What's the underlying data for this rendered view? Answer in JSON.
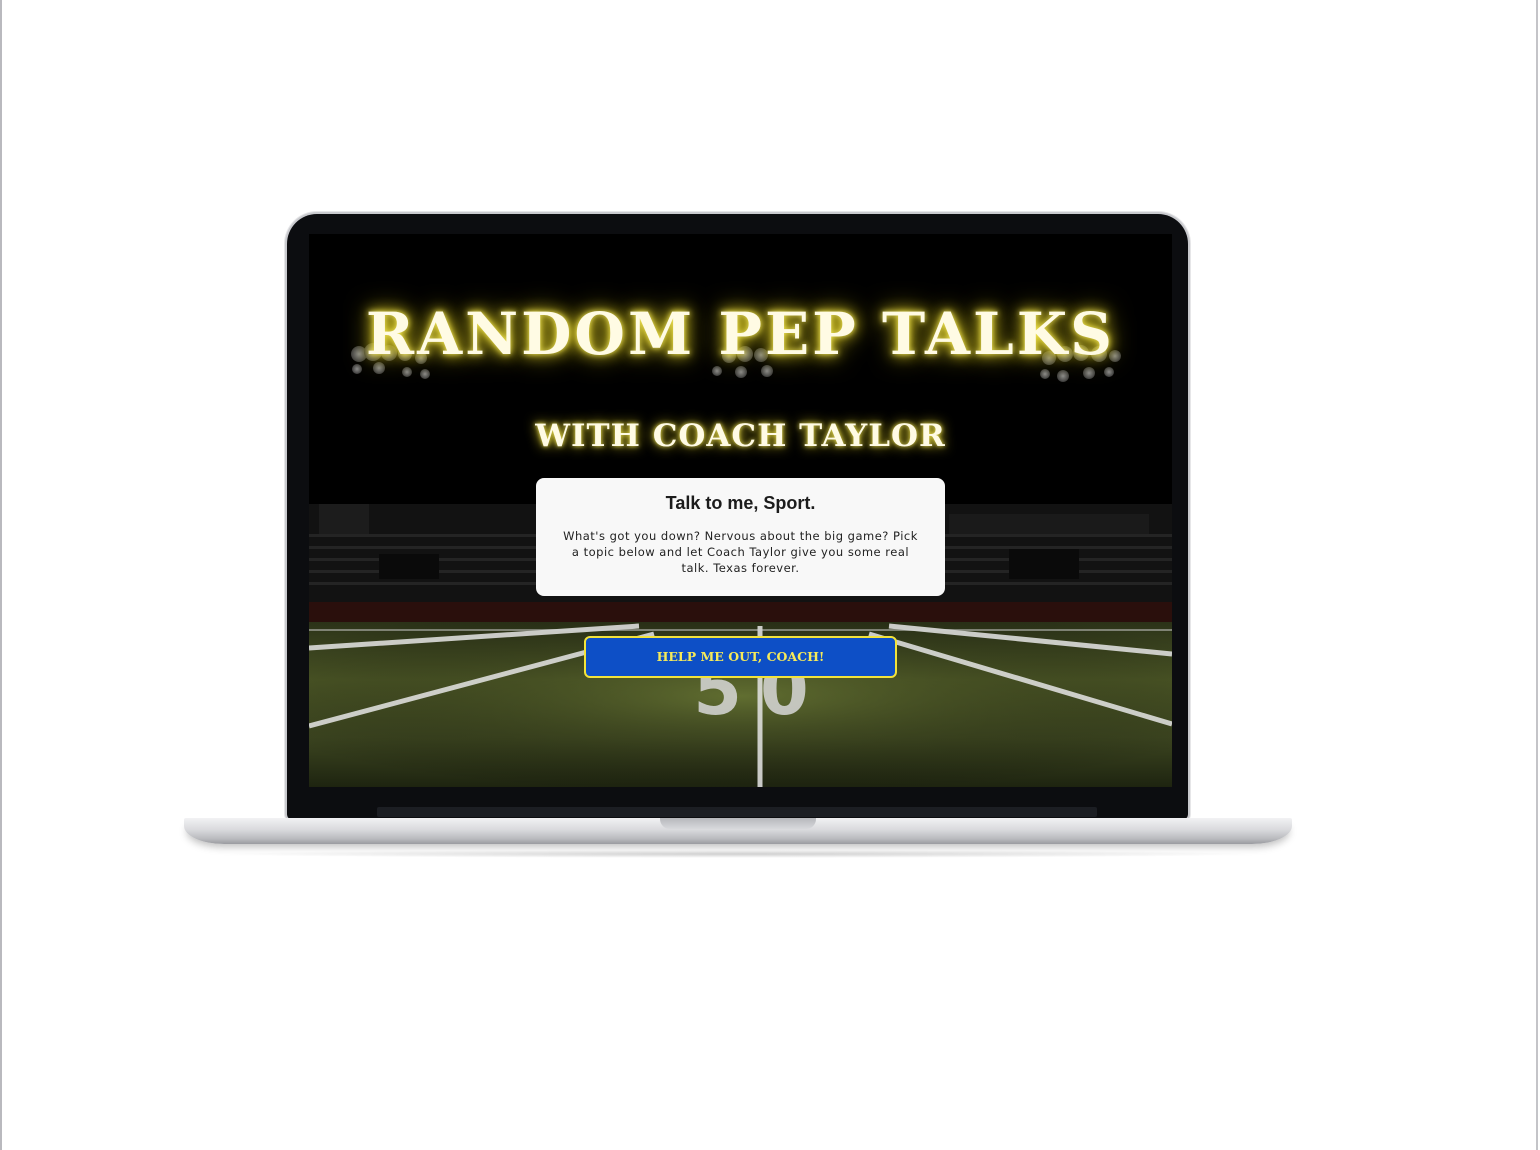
{
  "page": {
    "title": "RANDOM PEP TALKS",
    "subtitle": "WITH COACH TAYLOR"
  },
  "card": {
    "heading": "Talk to me, Sport.",
    "body": "What's got you down? Nervous about the big game? Pick a topic below and let Coach Taylor give you some real talk. Texas forever."
  },
  "cta": {
    "label": "HELP ME OUT, COACH!"
  },
  "field": {
    "yard_marker": "50"
  },
  "colors": {
    "accent_yellow": "#f2e33b",
    "button_blue": "#0d4fc6",
    "title_glow": "#e7d625"
  }
}
